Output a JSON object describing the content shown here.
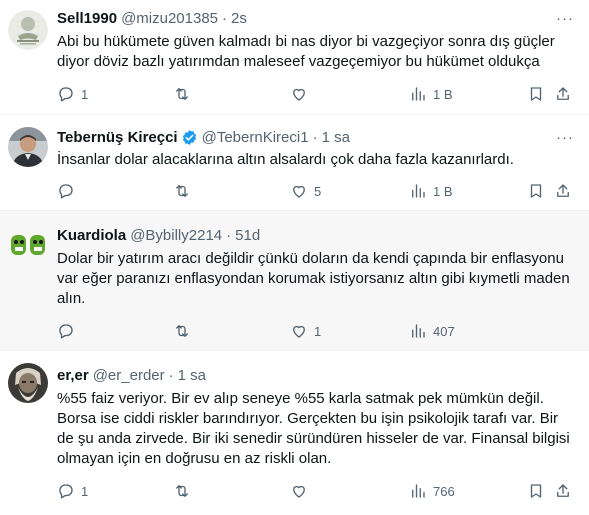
{
  "tweets": [
    {
      "name": "Sell1990",
      "handle": "@mizu201385",
      "dot": "·",
      "time": "2s",
      "verified": false,
      "text": "Abi bu hükümete güven kalmadı bi nas diyor bi vazgeçiyor sonra dış güçler diyor döviz bazlı yatırımdan maleseef vazgeçemiyor bu hükümet oldukça",
      "replies": "1",
      "retweets": "",
      "likes": "",
      "views": "1 B",
      "avatar": "logo-badge"
    },
    {
      "name": "Tebernüş Kireçci",
      "handle": "@TebernKireci1",
      "dot": "·",
      "time": "1 sa",
      "verified": true,
      "text": "İnsanlar dolar alacaklarına altın alsalardı çok daha fazla kazanırlardı.",
      "replies": "",
      "retweets": "",
      "likes": "5",
      "views": "1 B",
      "avatar": "man-portrait"
    },
    {
      "name": "Kuardiola",
      "handle": "@Bybilly2214",
      "dot": "·",
      "time": "51d",
      "verified": false,
      "text": "Dolar bir yatırım aracı değildir çünkü doların da kendi çapında bir enflasyonu var eğer paranızı enflasyondan korumak istiyorsanız altın gibi kıymetli maden alın.",
      "replies": "",
      "retweets": "",
      "likes": "1",
      "views": "407",
      "avatar": "green-creatures"
    },
    {
      "name": "er,er",
      "handle": "@er_erder",
      "dot": "·",
      "time": "1 sa",
      "verified": false,
      "text": "%55 faiz veriyor. Bir ev alıp seneye %55 karla satmak pek mümkün değil. Borsa ise ciddi riskler barındırıyor. Gerçekten bu işin psikolojik tarafı var. Bir de şu anda zirvede. Bir iki senedir süründüren hisseler de var. Finansal bilgisi olmayan için en doğrusu en az riskli olan.",
      "replies": "1",
      "retweets": "",
      "likes": "",
      "views": "766",
      "avatar": "old-man-portrait"
    }
  ],
  "colors": {
    "text": "#0f1419",
    "muted": "#536471",
    "verified": "#1d9bf0",
    "divider": "#eff3f4",
    "highlight": "#f7f7f7"
  },
  "icons": {
    "reply": "reply-icon",
    "retweet": "retweet-icon",
    "like": "heart-icon",
    "views": "views-icon",
    "bookmark": "bookmark-icon",
    "share": "share-icon",
    "more": "more-icon"
  }
}
